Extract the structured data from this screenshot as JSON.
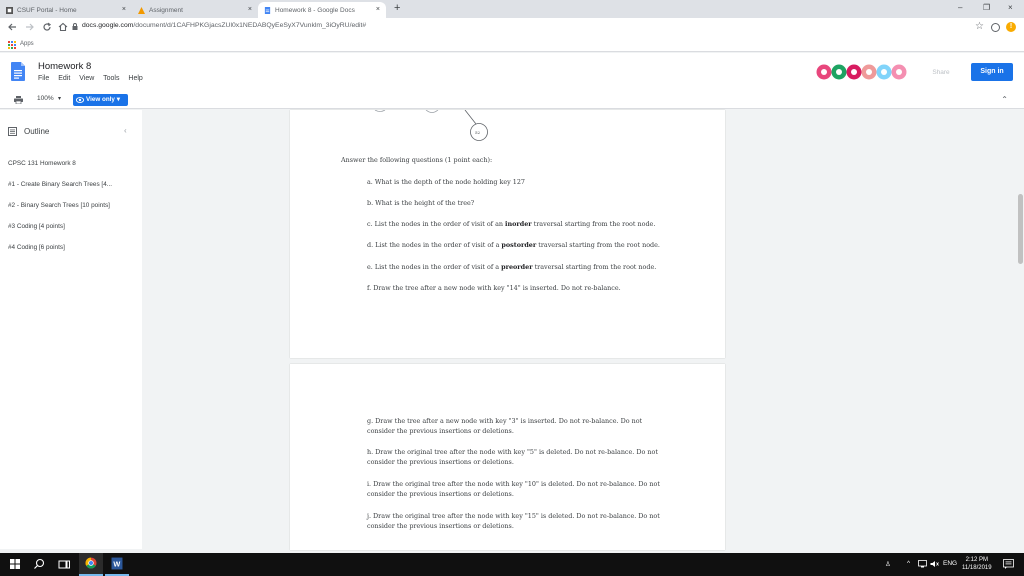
{
  "browser": {
    "tabs": [
      {
        "title": "CSUF Portal - Home"
      },
      {
        "title": "Assignment"
      },
      {
        "title": "Homework 8 - Google Docs"
      }
    ],
    "close_glyph": "×",
    "new_tab_glyph": "+",
    "window_controls": [
      "–",
      "❐",
      "×"
    ],
    "url_host": "docs.google.com",
    "url_path": "/document/d/1CAFHPKGjacsZUl0x1NEDABQyEeSyX7Vunklm_3iOyRU/edit#",
    "bookmarks_apps": "Apps",
    "nav_icons": [
      "back-arrow-icon",
      "forward-arrow-icon",
      "reload-icon",
      "home-icon"
    ],
    "colors": {
      "accent": "#1a73e8",
      "tabstrip": "#dee1e6"
    }
  },
  "docs": {
    "title": "Homework 8",
    "menus": [
      "File",
      "Edit",
      "View",
      "Tools",
      "Help"
    ],
    "share_label": "Share",
    "sign_in_label": "Sign in",
    "zoom": "100%",
    "view_mode": "View only",
    "caret": "▾",
    "collapse_glyph": "⌃"
  },
  "outline": {
    "title": "Outline",
    "close_glyph": "‹",
    "items": [
      "CPSC 131 Homework 8",
      "#1 - Create Binary Search Trees [4...",
      "#2 - Binary Search Trees [10 points]",
      "#3 Coding [4 points]",
      "#4 Coding [6 points]"
    ]
  },
  "page1": {
    "node_label": "52",
    "intro": "Answer the following questions (1 point each):",
    "q_a": "a. What is the depth of the node holding key 127",
    "q_b": "b. What is the height of the tree?",
    "q_c_pre": "c. List the nodes in the order of visit of an ",
    "q_c_bold": "inorder",
    "q_c_post": " traversal starting from the root node.",
    "q_d_pre": "d. List the nodes in the order of visit of a ",
    "q_d_bold": "postorder",
    "q_d_post": " traversal starting from the root node.",
    "q_e_pre": "e. List the nodes in the order of visit of a ",
    "q_e_bold": "preorder",
    "q_e_post": " traversal starting from the root node.",
    "q_f": "f. Draw the tree after a new node with key \"14\" is inserted. Do not re-balance."
  },
  "page2": {
    "q_g": "g. Draw the tree after a new node with key \"3\" is inserted. Do not re-balance. Do not consider the previous insertions or deletions.",
    "q_h": "h. Draw the original tree after the node with key \"5\" is deleted. Do not re-balance. Do not consider the previous insertions or deletions.",
    "q_i": "i. Draw the original tree after the node with key \"10\" is deleted. Do not re-balance. Do not consider the previous insertions or deletions.",
    "q_j": "j. Draw the original tree after the node with key \"15\" is deleted. Do not re-balance. Do not consider the previous insertions or deletions."
  },
  "taskbar": {
    "language": "ENG",
    "time": "2:12 PM",
    "date": "11/18/2019"
  }
}
